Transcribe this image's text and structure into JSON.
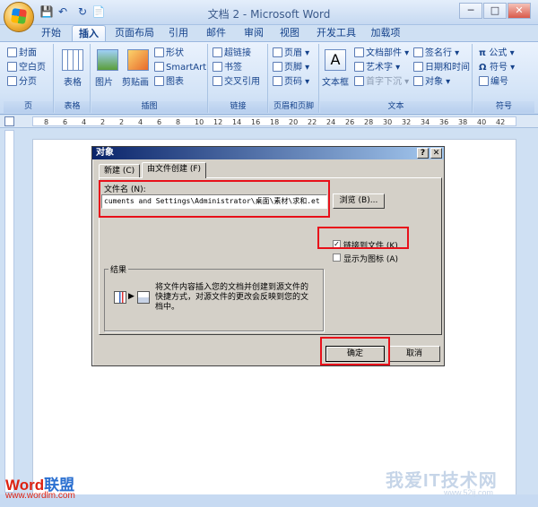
{
  "window": {
    "title": "文档 2 - Microsoft Word",
    "minimize": "─",
    "restore": "□",
    "close": "✕"
  },
  "qat": {
    "save": "💾",
    "undo": "↶",
    "redo": "↻",
    "new": "📄"
  },
  "tabs": [
    {
      "label": "开始"
    },
    {
      "label": "插入"
    },
    {
      "label": "页面布局"
    },
    {
      "label": "引用"
    },
    {
      "label": "邮件"
    },
    {
      "label": "审阅"
    },
    {
      "label": "视图"
    },
    {
      "label": "开发工具"
    },
    {
      "label": "加载项"
    }
  ],
  "ribbon": {
    "pages": {
      "label": "页",
      "items": [
        "封面",
        "空白页",
        "分页"
      ]
    },
    "table": {
      "label": "表格",
      "button": "表格"
    },
    "illustrations": {
      "label": "插图",
      "picture": "图片",
      "clipart": "剪贴画",
      "shapes": "形状",
      "smartart": "SmartArt",
      "chart": "图表"
    },
    "links": {
      "label": "链接",
      "hyperlink": "超链接",
      "bookmark": "书签",
      "crossref": "交叉引用"
    },
    "headerfooter": {
      "label": "页眉和页脚",
      "header": "页眉",
      "footer": "页脚",
      "pagenum": "页码"
    },
    "text": {
      "label": "文本",
      "textbox": "文本框",
      "quickparts": "文档部件",
      "wordart": "艺术字",
      "dropcap": "首字下沉",
      "signature": "签名行",
      "datetime": "日期和时间",
      "object": "对象"
    },
    "symbols": {
      "label": "符号",
      "equation": "公式",
      "symbol": "符号",
      "number": "编号"
    }
  },
  "ruler": {
    "numbers": [
      "8",
      "6",
      "4",
      "2",
      "2",
      "4",
      "6",
      "8",
      "10",
      "12",
      "14",
      "16",
      "18",
      "20",
      "22",
      "24",
      "26",
      "28",
      "30",
      "32",
      "34",
      "36",
      "38",
      "40",
      "42"
    ]
  },
  "dialog": {
    "title": "对象",
    "help": "?",
    "close": "✕",
    "tab_new": "新建 (C)",
    "tab_fromfile": "由文件创建 (F)",
    "filename_label": "文件名 (N):",
    "filename_value": "cuments and Settings\\Administrator\\桌面\\素材\\求和.et",
    "browse": "浏览 (B)...",
    "link_to_file": "链接到文件 (K)",
    "link_checked": "✓",
    "show_as_icon": "显示为图标 (A)",
    "result_label": "结果",
    "result_text": [
      "将文件内容插入您的文档并创建到源文件的",
      "快捷方式，对源文件的更改会反映到您的文",
      "档中。"
    ],
    "ok": "确定",
    "cancel": "取消"
  },
  "watermarks": {
    "left_brand_a": "Word",
    "left_brand_b": "联盟",
    "left_url": "www.wordlm.com",
    "right_brand": "我爱IT技术网",
    "right_url": "www.52ij.com"
  },
  "colors": {
    "accent": "#15428b",
    "highlight": "#e8101a",
    "dialog_title": "#0a246a"
  }
}
